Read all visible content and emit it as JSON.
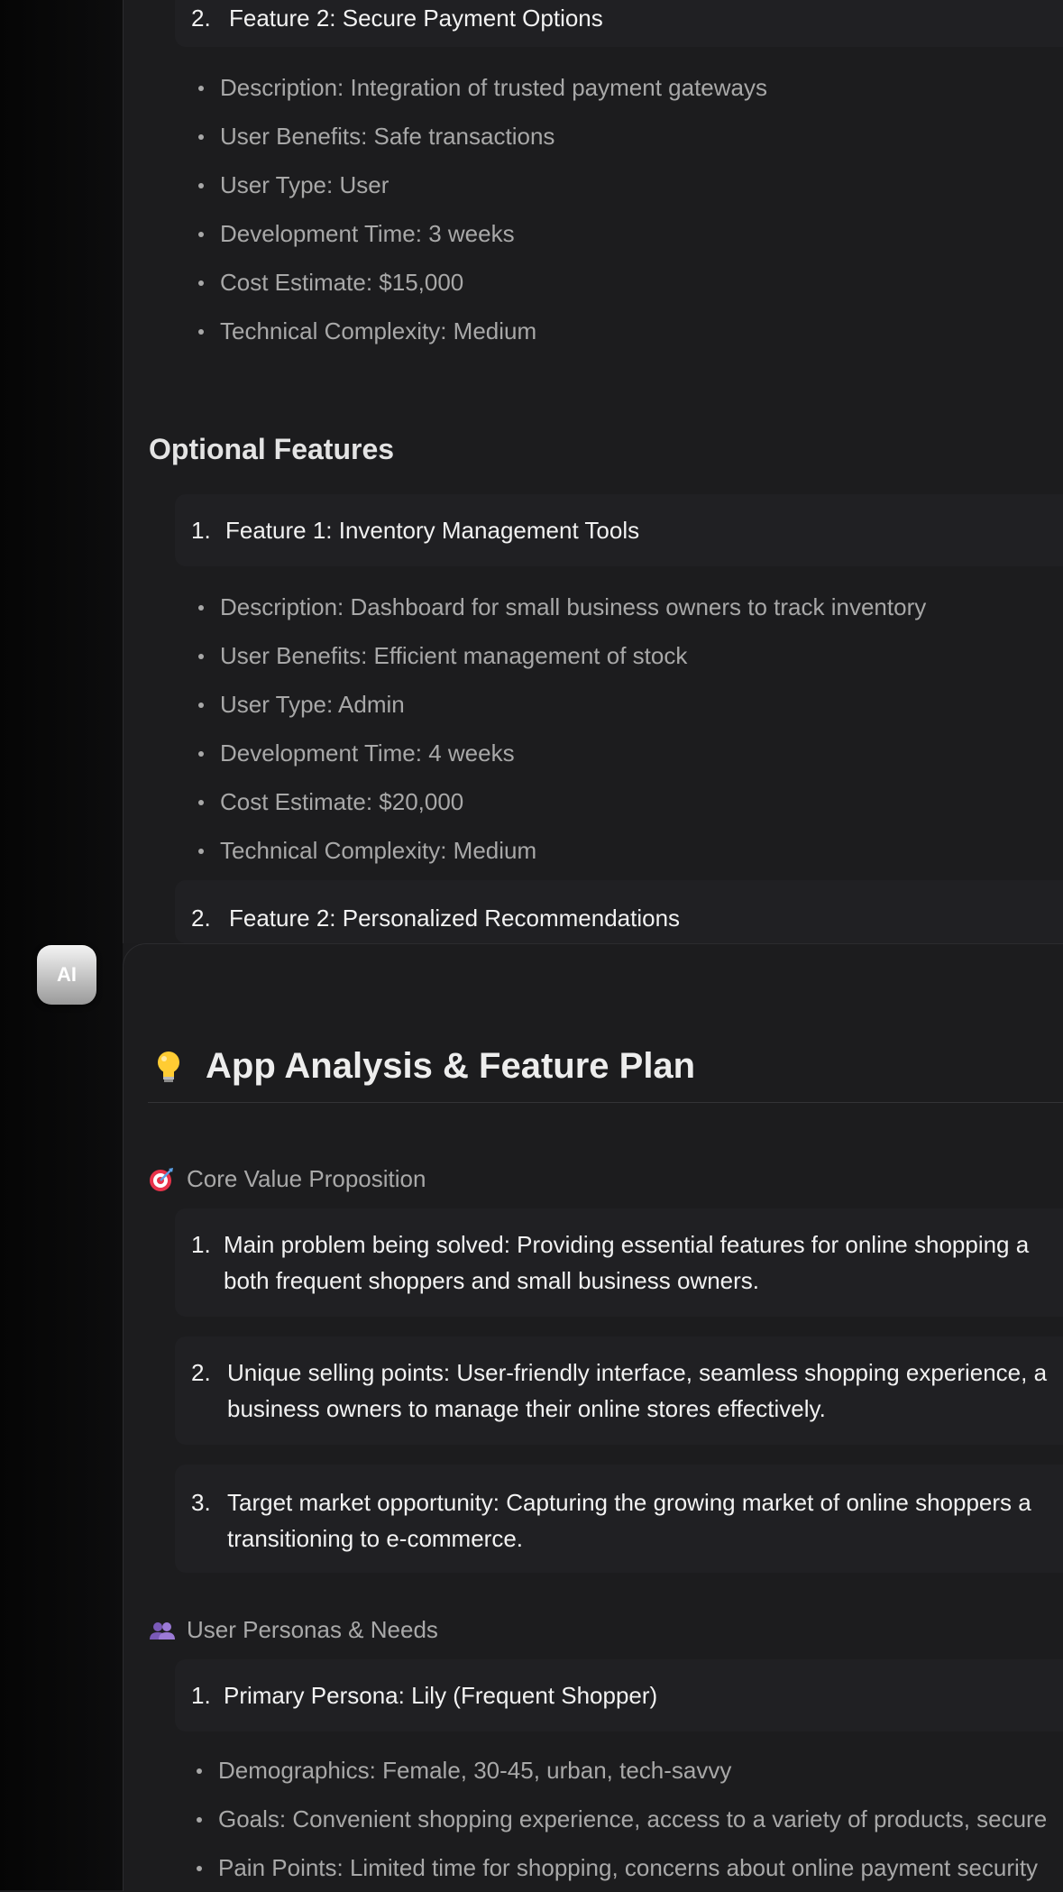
{
  "top_section": {
    "feature2_number": "2.",
    "feature2_title": "Feature 2: Secure Payment Options",
    "feature2_bullets": [
      "Description: Integration of trusted payment gateways",
      "User Benefits: Safe transactions",
      "User Type: User",
      "Development Time: 3 weeks",
      "Cost Estimate: $15,000",
      "Technical Complexity: Medium"
    ],
    "optional_heading": "Optional Features",
    "opt1_number": "1.",
    "opt1_title": "Feature 1: Inventory Management Tools",
    "opt1_bullets": [
      "Description: Dashboard for small business owners to track inventory",
      "User Benefits: Efficient management of stock",
      "User Type: Admin",
      "Development Time: 4 weeks",
      "Cost Estimate: $20,000",
      "Technical Complexity: Medium"
    ],
    "opt2_number": "2.",
    "opt2_title": "Feature 2: Personalized Recommendations"
  },
  "ai_message": {
    "avatar_label": "AI",
    "heading": "App Analysis & Feature Plan",
    "heading_icon": "lightbulb-icon",
    "core_value_icon": "target-icon",
    "core_value_heading": "Core Value Proposition",
    "core_items": [
      {
        "number": "1.",
        "line1": "Main problem being solved: Providing essential features for online shopping a",
        "line2": "both frequent shoppers and small business owners."
      },
      {
        "number": "2.",
        "line1": "Unique selling points: User-friendly interface, seamless shopping experience, a",
        "line2": "business owners to manage their online stores effectively."
      },
      {
        "number": "3.",
        "line1": "Target market opportunity: Capturing the growing market of online shoppers a",
        "line2": "transitioning to e-commerce."
      }
    ],
    "personas_icon": "users-icon",
    "personas_heading": "User Personas & Needs",
    "persona1_number": "1.",
    "persona1_title": "Primary Persona: Lily (Frequent Shopper)",
    "persona1_bullets": [
      "Demographics: Female, 30-45, urban, tech-savvy",
      "Goals: Convenient shopping experience, access to a variety of products, secure",
      "Pain Points: Limited time for shopping, concerns about online payment security"
    ]
  }
}
